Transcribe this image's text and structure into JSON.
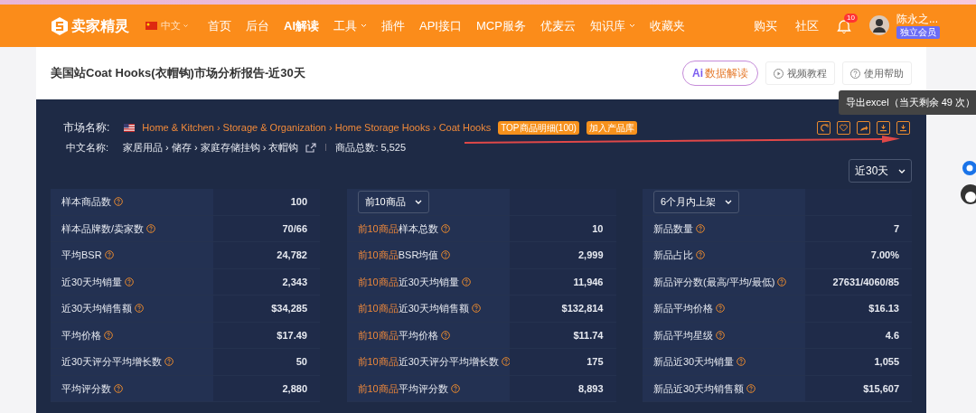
{
  "nav": {
    "logo": "卖家精灵",
    "language": "中文",
    "items": [
      {
        "label": "首页",
        "dropdown": false,
        "bold": false
      },
      {
        "label": "后台",
        "dropdown": false,
        "bold": false
      },
      {
        "label": "AI解读",
        "dropdown": false,
        "bold": true
      },
      {
        "label": "工具",
        "dropdown": true,
        "bold": false
      },
      {
        "label": "插件",
        "dropdown": false,
        "bold": false
      },
      {
        "label": "API接口",
        "dropdown": false,
        "bold": false
      },
      {
        "label": "MCP服务",
        "dropdown": false,
        "bold": false
      },
      {
        "label": "优麦云",
        "dropdown": false,
        "bold": false
      },
      {
        "label": "知识库",
        "dropdown": true,
        "bold": false
      },
      {
        "label": "收藏夹",
        "dropdown": false,
        "bold": false
      }
    ],
    "right_links": [
      "购买",
      "社区"
    ],
    "notification_count": "10",
    "user_name": "陈永之...",
    "member_badge": "独立会员"
  },
  "page": {
    "title": "美国站Coat Hooks(衣帽钩)市场分析报告-近30天",
    "ai_button": "数据解读",
    "ai_logo": "Ai",
    "buttons": [
      "视频教程",
      "使用帮助"
    ]
  },
  "tooltip": "导出excel（当天剩余 49 次）",
  "market": {
    "label": "市场名称:",
    "path": "Home & Kitchen › Storage & Organization › Home Storage Hooks › Coat Hooks",
    "tags": [
      "TOP商品明细(100)",
      "加入产品库"
    ],
    "cn_label": "中文名称:",
    "cn_path": "家居用品 › 储存 › 家庭存储挂钩 › 衣帽钩",
    "total": "商品总数: 5,525",
    "period": "近30天"
  },
  "columns": [
    {
      "rows": [
        {
          "highlight": "",
          "label": "样本商品数",
          "value": "100"
        },
        {
          "highlight": "",
          "label": "样本品牌数/卖家数",
          "value": "70/66"
        },
        {
          "highlight": "",
          "label": "平均BSR",
          "value": "24,782"
        },
        {
          "highlight": "",
          "label": "近30天均销量",
          "value": "2,343"
        },
        {
          "highlight": "",
          "label": "近30天均销售额",
          "value": "$34,285"
        },
        {
          "highlight": "",
          "label": "平均价格",
          "value": "$17.49"
        },
        {
          "highlight": "",
          "label": "近30天评分平均增长数",
          "value": "50"
        },
        {
          "highlight": "",
          "label": "平均评分数",
          "value": "2,880"
        }
      ]
    },
    {
      "select": "前10商品",
      "rows": [
        {
          "highlight": "前10商品",
          "label": "样本总数",
          "value": "10"
        },
        {
          "highlight": "前10商品",
          "label": "BSR均值",
          "value": "2,999"
        },
        {
          "highlight": "前10商品",
          "label": "近30天均销量",
          "value": "11,946"
        },
        {
          "highlight": "前10商品",
          "label": "近30天均销售额",
          "value": "$132,814"
        },
        {
          "highlight": "前10商品",
          "label": "平均价格",
          "value": "$11.74"
        },
        {
          "highlight": "前10商品",
          "label": "近30天评分平均增长数",
          "value": "175"
        },
        {
          "highlight": "前10商品",
          "label": "平均评分数",
          "value": "8,893"
        }
      ]
    },
    {
      "select": "6个月内上架",
      "rows": [
        {
          "highlight": "",
          "label": "新品数量",
          "value": "7"
        },
        {
          "highlight": "",
          "label": "新品占比",
          "value": "7.00%"
        },
        {
          "highlight": "",
          "label": "新品评分数(最高/平均/最低)",
          "value": "27631/4060/85"
        },
        {
          "highlight": "",
          "label": "新品平均价格",
          "value": "$16.13"
        },
        {
          "highlight": "",
          "label": "新品平均星级",
          "value": "4.6"
        },
        {
          "highlight": "",
          "label": "新品近30天均销量",
          "value": "1,055"
        },
        {
          "highlight": "",
          "label": "新品近30天均销售额",
          "value": "$15,607"
        }
      ]
    }
  ]
}
